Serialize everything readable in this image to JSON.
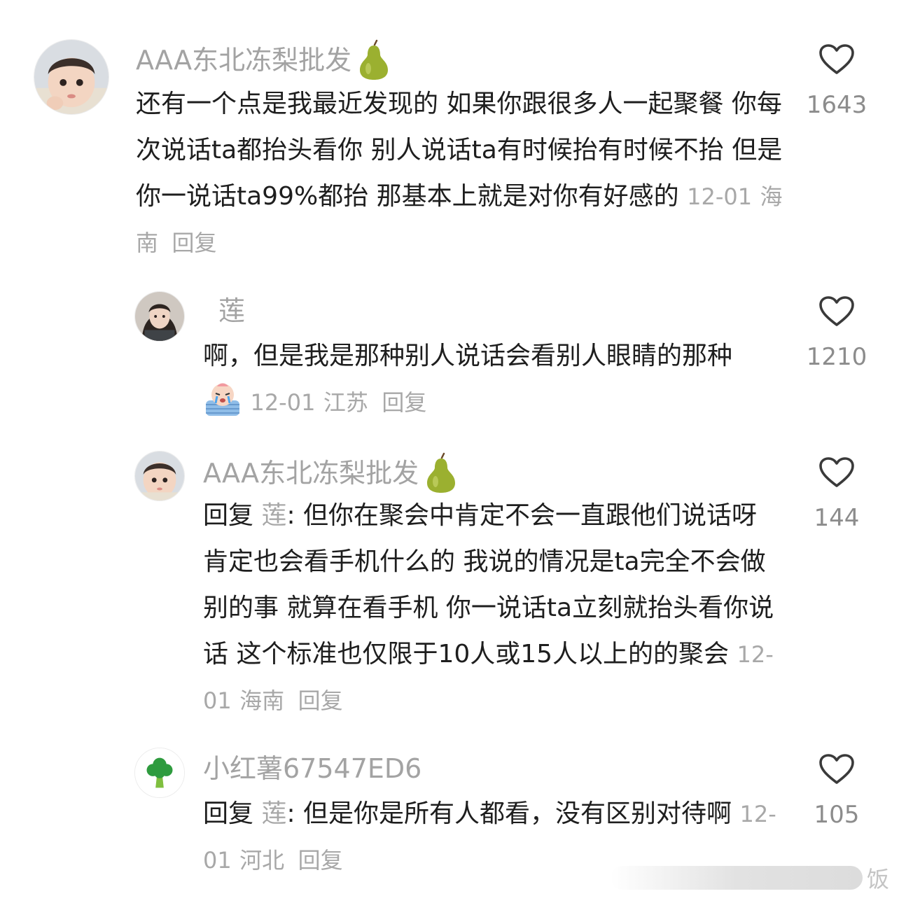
{
  "comments": [
    {
      "author": "AAA东北冻梨批发",
      "text": "还有一个点是我最近发现的 如果你跟很多人一起聚餐 你每次说话ta都抬头看你 别人说话ta有时候抬有时候不抬 但是你一说话ta99%都抬 那基本上就是对你有好感的",
      "date": "12-01",
      "location": "海南",
      "reply_label": "回复",
      "likes": "1643"
    },
    {
      "author": "莲",
      "text": "啊，但是我是那种别人说话会看别人眼睛的那种",
      "date": "12-01",
      "location": "江苏",
      "reply_label": "回复",
      "likes": "1210"
    },
    {
      "author": "AAA东北冻梨批发",
      "reply_prefix": "回复",
      "reply_target": "莲",
      "text": ": 但你在聚会中肯定不会一直跟他们说话呀 肯定也会看手机什么的 我说的情况是ta完全不会做别的事 就算在看手机 你一说话ta立刻就抬头看你说话 这个标准也仅限于10人或15人以上的的聚会",
      "date": "12-01",
      "location": "海南",
      "reply_label": "回复",
      "likes": "144"
    },
    {
      "author": "小红薯67547ED6",
      "reply_prefix": "回复",
      "reply_target": "莲",
      "text": ": 但是你是所有人都看，没有区别对待啊",
      "date": "12-01",
      "location": "河北",
      "reply_label": "回复",
      "likes": "105"
    }
  ],
  "icons": {
    "like": "heart-outline-icon",
    "author_badge": "pear-emoji",
    "emoji": "crying-emoji",
    "avatar_4": "broccoli-icon"
  },
  "colors": {
    "text": "#1e1e1e",
    "meta": "#a8a8a8",
    "author": "#a3a3a3",
    "pear": "#9bb030"
  },
  "watermark": {
    "char": "饭"
  }
}
